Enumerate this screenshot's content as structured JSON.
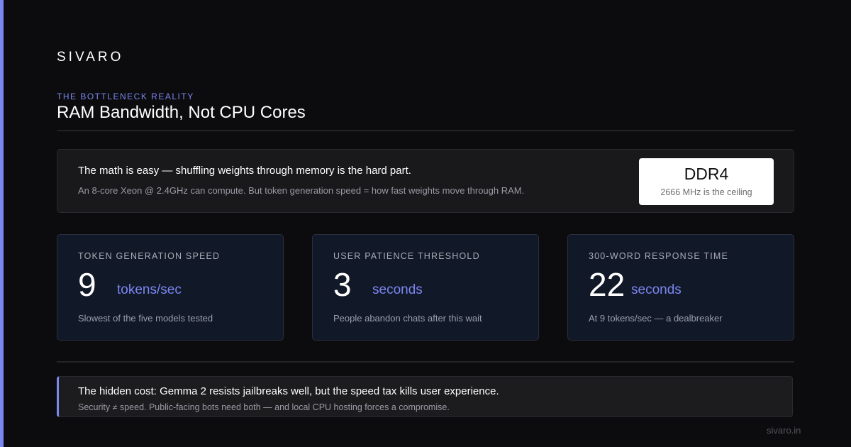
{
  "brand": "SIVARO",
  "header": {
    "eyebrow": "THE BOTTLENECK REALITY",
    "title": "RAM Bandwidth, Not CPU Cores"
  },
  "hero": {
    "main": "The math is easy — shuffling weights through memory is the hard part.",
    "sub": "An 8-core Xeon @ 2.4GHz can compute. But token generation speed = how fast weights move through RAM.",
    "badge": {
      "title": "DDR4",
      "sub": "2666 MHz is the ceiling"
    }
  },
  "stats": [
    {
      "label": "TOKEN GENERATION SPEED",
      "value": "9",
      "unit": "tokens/sec",
      "note": "Slowest of the five models tested"
    },
    {
      "label": "USER PATIENCE THRESHOLD",
      "value": "3",
      "unit": "seconds",
      "note": "People abandon chats after this wait"
    },
    {
      "label": "300-WORD RESPONSE TIME",
      "value": "22",
      "unit": "seconds",
      "note": "At 9 tokens/sec — a dealbreaker"
    }
  ],
  "callout": {
    "main": "The hidden cost: Gemma 2 resists jailbreaks well, but the speed tax kills user experience.",
    "sub": "Security ≠ speed. Public-facing bots need both — and local CPU hosting forces a compromise."
  },
  "footer": "sivaro.in",
  "colors": {
    "accent": "#7c86f0",
    "background": "#0c0c0e",
    "card": "#19191c",
    "stat_card": "#111827"
  }
}
